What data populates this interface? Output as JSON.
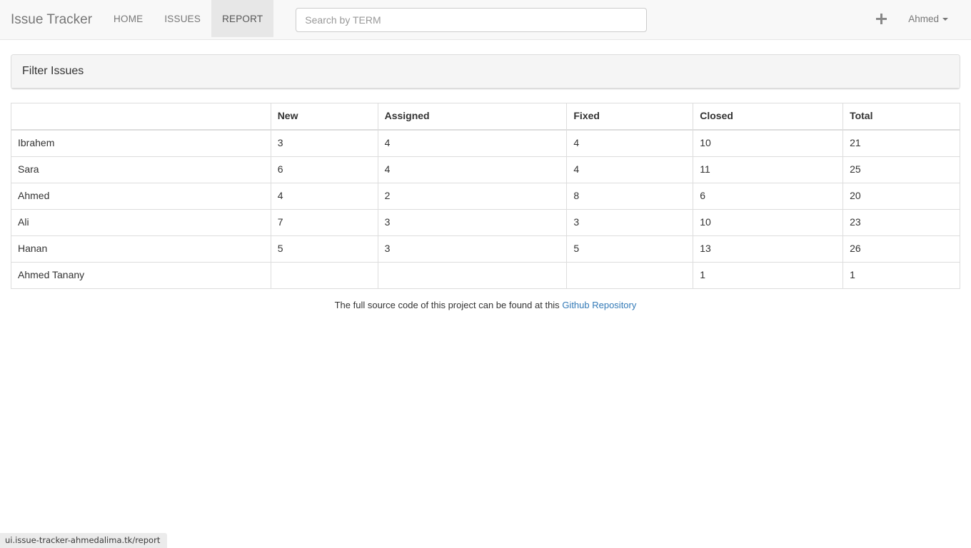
{
  "navbar": {
    "brand": "Issue Tracker",
    "links": [
      {
        "label": "HOME",
        "active": false
      },
      {
        "label": "ISSUES",
        "active": false
      },
      {
        "label": "REPORT",
        "active": true
      }
    ],
    "search": {
      "placeholder": "Search by TERM",
      "value": ""
    },
    "add_icon": "plus-icon",
    "user": {
      "name": "Ahmed",
      "caret_icon": "caret-down-icon"
    }
  },
  "panel": {
    "title": "Filter Issues"
  },
  "table": {
    "columns": [
      "",
      "New",
      "Assigned",
      "Fixed",
      "Closed",
      "Total"
    ],
    "rows": [
      {
        "owner": "Ibrahem",
        "new": "3",
        "assigned": "4",
        "fixed": "4",
        "closed": "10",
        "total": "21"
      },
      {
        "owner": "Sara",
        "new": "6",
        "assigned": "4",
        "fixed": "4",
        "closed": "11",
        "total": "25"
      },
      {
        "owner": "Ahmed",
        "new": "4",
        "assigned": "2",
        "fixed": "8",
        "closed": "6",
        "total": "20"
      },
      {
        "owner": "Ali",
        "new": "7",
        "assigned": "3",
        "fixed": "3",
        "closed": "10",
        "total": "23"
      },
      {
        "owner": "Hanan",
        "new": "5",
        "assigned": "3",
        "fixed": "5",
        "closed": "13",
        "total": "26"
      },
      {
        "owner": "Ahmed Tanany",
        "new": "",
        "assigned": "",
        "fixed": "",
        "closed": "1",
        "total": "1"
      }
    ]
  },
  "footer": {
    "text": "The full source code of this project can be found at this",
    "link_label": "Github Repository"
  },
  "status_bar": {
    "url": "ui.issue-tracker-ahmedalima.tk/report"
  },
  "colors": {
    "navbar_bg": "#f8f8f8",
    "navbar_border": "#e7e7e7",
    "active_tab_bg": "#e7e7e7",
    "panel_heading_bg": "#f5f5f5",
    "border": "#dddddd",
    "link": "#337ab7",
    "text": "#333333",
    "muted": "#777777"
  }
}
